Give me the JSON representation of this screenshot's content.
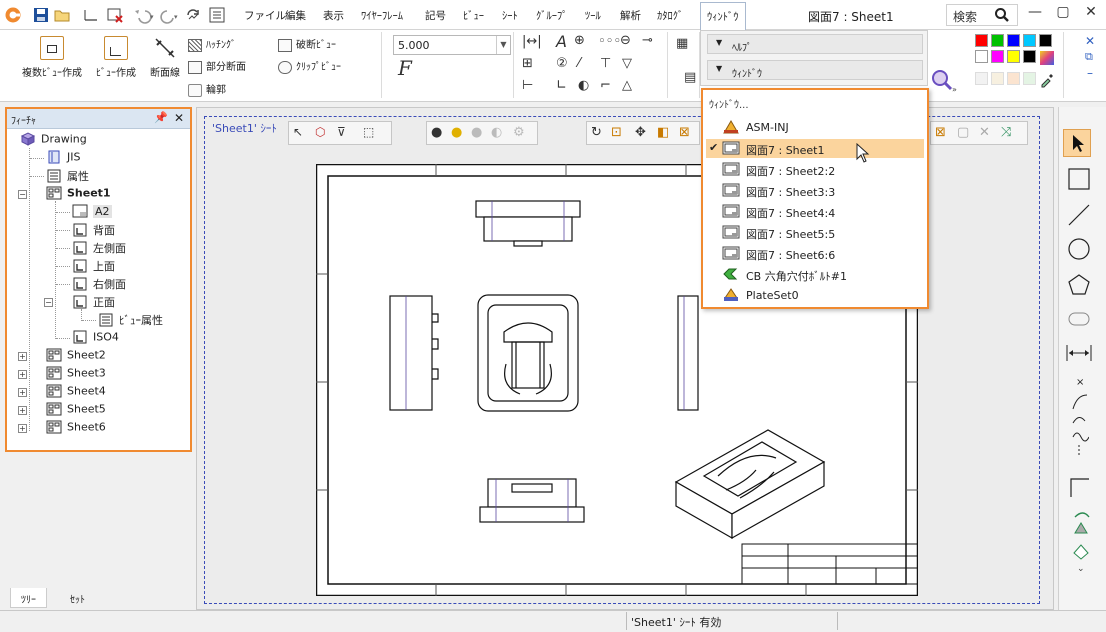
{
  "menubar": {
    "items": [
      "ファイル",
      "編集",
      "表示",
      "ﾜｲﾔｰﾌﾚｰﾑ",
      "記号",
      "ﾋﾞｭｰ",
      "ｼｰﾄ",
      "ｸﾞﾙｰﾌﾟ",
      "ﾂｰﾙ",
      "解析",
      "ｶﾀﾛｸﾞ",
      "ｳｨﾝﾄﾞｳ"
    ],
    "active_item": "ｳｨﾝﾄﾞｳ",
    "document_title": "図面7 : Sheet1",
    "search_label": "検索"
  },
  "ribbon": {
    "multi_view_label": "複数ﾋﾞｭｰ作成",
    "view_create_label": "ﾋﾞｭｰ作成",
    "section_line_label": "断面線",
    "hatching_label": "ﾊｯﾁﾝｸﾞ",
    "partial_section_label": "部分断面",
    "contour_label": "輪郭",
    "break_view_label": "破断ﾋﾞｭｰ",
    "clip_view_label": "ｸﾘｯﾌﾟﾋﾞｭｰ",
    "line_width_value": "5.000",
    "font_symbol": "F",
    "palette_colors": [
      "#ff0000",
      "#00c000",
      "#0000ff",
      "#00c8ff",
      "#000000",
      "#ffffff",
      "#ff00ff",
      "#ffff00",
      "#000000",
      "#f2f2f2",
      "#f7f0e0",
      "#fbe4d0",
      "#e4f4e4",
      "#e0f0f4"
    ]
  },
  "window_menu": {
    "help_label": "ﾍﾙﾌﾟ",
    "window_label": "ｳｨﾝﾄﾞｳ"
  },
  "window_dropdown": {
    "header": "ｳｨﾝﾄﾞｳ...",
    "items": [
      {
        "label": "ASM-INJ",
        "icon": "assembly-icon",
        "checked": false,
        "selected": false
      },
      {
        "label": "図面7 : Sheet1",
        "icon": "drawing-sheet-icon",
        "checked": true,
        "selected": true
      },
      {
        "label": "図面7 : Sheet2:2",
        "icon": "drawing-sheet-icon",
        "checked": false,
        "selected": false
      },
      {
        "label": "図面7 : Sheet3:3",
        "icon": "drawing-sheet-icon",
        "checked": false,
        "selected": false
      },
      {
        "label": "図面7 : Sheet4:4",
        "icon": "drawing-sheet-icon",
        "checked": false,
        "selected": false
      },
      {
        "label": "図面7 : Sheet5:5",
        "icon": "drawing-sheet-icon",
        "checked": false,
        "selected": false
      },
      {
        "label": "図面7 : Sheet6:6",
        "icon": "drawing-sheet-icon",
        "checked": false,
        "selected": false
      },
      {
        "label": "CB 六角穴付ﾎﾞﾙﾄ#1",
        "icon": "bolt-part-icon",
        "checked": false,
        "selected": false
      },
      {
        "label": "PlateSet0",
        "icon": "plate-assembly-icon",
        "checked": false,
        "selected": false
      }
    ]
  },
  "feature_panel": {
    "title": "ﾌｨｰﾁｬ",
    "tree": [
      {
        "label": "Drawing",
        "icon": "drawing-root-icon"
      },
      {
        "label": "JIS",
        "icon": "standard-icon"
      },
      {
        "label": "属性",
        "icon": "properties-icon"
      },
      {
        "label": "Sheet1",
        "icon": "sheet-icon"
      },
      {
        "label": "A2",
        "icon": "paper-size-icon"
      },
      {
        "label": "背面",
        "icon": "view-icon"
      },
      {
        "label": "左側面",
        "icon": "view-icon"
      },
      {
        "label": "上面",
        "icon": "view-icon"
      },
      {
        "label": "右側面",
        "icon": "view-icon"
      },
      {
        "label": "正面",
        "icon": "view-icon"
      },
      {
        "label": "ﾋﾞｭｰ属性",
        "icon": "view-properties-icon"
      },
      {
        "label": "ISO4",
        "icon": "view-icon"
      },
      {
        "label": "Sheet2",
        "icon": "sheet-icon"
      },
      {
        "label": "Sheet3",
        "icon": "sheet-icon"
      },
      {
        "label": "Sheet4",
        "icon": "sheet-icon"
      },
      {
        "label": "Sheet5",
        "icon": "sheet-icon"
      },
      {
        "label": "Sheet6",
        "icon": "sheet-icon"
      }
    ],
    "tabs": [
      "ﾂﾘｰ",
      "ｾｯﾄ"
    ]
  },
  "canvas": {
    "sheet_label": "'Sheet1' ｼｰﾄ",
    "accent_color": "#3a4bb8"
  },
  "status": {
    "text": "'Sheet1' ｼｰﾄ 有効"
  },
  "colors": {
    "highlight_border": "#f08a30",
    "selected_item": "#fbd49d"
  }
}
